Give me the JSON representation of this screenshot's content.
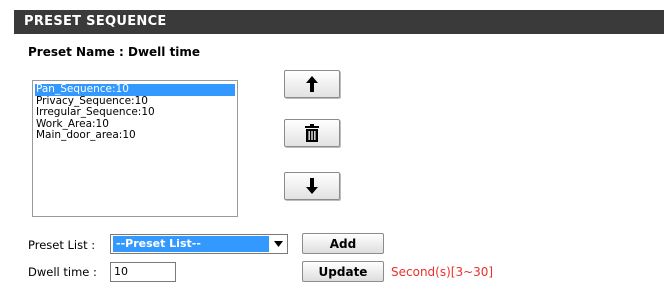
{
  "section": {
    "title": "PRESET SEQUENCE"
  },
  "preset_name": "Preset Name : Dwell time",
  "sequence_list": {
    "items": [
      {
        "label": "Pan_Sequence:10",
        "selected": true
      },
      {
        "label": "Privacy_Sequence:10",
        "selected": false
      },
      {
        "label": "Irregular_Sequence:10",
        "selected": false
      },
      {
        "label": "Work_Area:10",
        "selected": false
      },
      {
        "label": "Main_door_area:10",
        "selected": false
      }
    ]
  },
  "controls": {
    "move_up_icon": "arrow-up-icon",
    "delete_icon": "trash-icon",
    "move_down_icon": "arrow-down-icon"
  },
  "preset_list": {
    "label": "Preset List :",
    "selected": "--Preset List--",
    "add_label": "Add"
  },
  "dwell": {
    "label": "Dwell time :",
    "value": "10",
    "update_label": "Update",
    "hint": "Second(s)[3~30]"
  },
  "colors": {
    "header_bg": "#3a3a3a",
    "selection": "#3399ff",
    "hint": "#e8302a"
  }
}
